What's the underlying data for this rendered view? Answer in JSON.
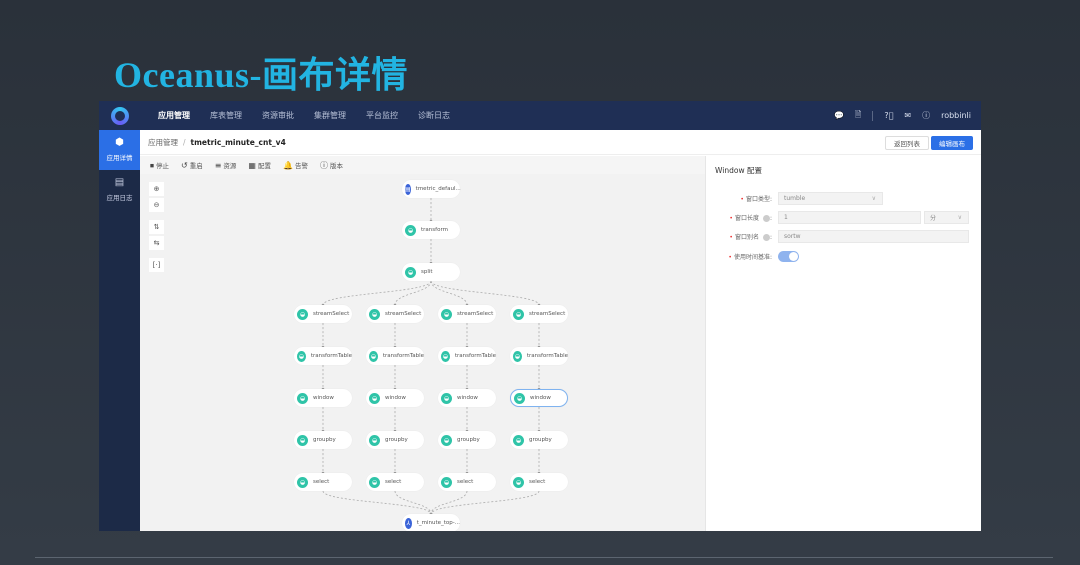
{
  "slide_title": "Oceanus-画布详情",
  "nav": {
    "items": [
      "应用管理",
      "库表管理",
      "资源审批",
      "集群管理",
      "平台监控",
      "诊断日志"
    ],
    "active": 0,
    "user": "robbinli"
  },
  "sidebar": [
    {
      "label": "应用详情",
      "icon": "cube-icon",
      "active": true
    },
    {
      "label": "应用日志",
      "icon": "log-icon",
      "active": false
    }
  ],
  "breadcrumb": {
    "parent": "应用管理",
    "separator": "/",
    "current": "tmetric_minute_cnt_v4"
  },
  "buttons": {
    "back": "返回列表",
    "edit": "编辑画布"
  },
  "toolbar": [
    {
      "icon": "⏹",
      "label": "停止"
    },
    {
      "icon": "↺",
      "label": "重启"
    },
    {
      "icon": "≡",
      "label": "资源"
    },
    {
      "icon": "▦",
      "label": "配置"
    },
    {
      "icon": "🔔",
      "label": "告警"
    },
    {
      "icon": "ⓘ",
      "label": "版本"
    }
  ],
  "canvas_tools": [
    "zoom-in",
    "zoom-out",
    "align-top",
    "align-left",
    "fit"
  ],
  "graph": {
    "source": "tmetric_defaul...",
    "chain": [
      "transform",
      "split"
    ],
    "columns": [
      [
        "streamSelect",
        "transformTable",
        "window",
        "groupby",
        "select"
      ],
      [
        "streamSelect",
        "transformTable",
        "window",
        "groupby",
        "select"
      ],
      [
        "streamSelect",
        "transformTable",
        "window",
        "groupby",
        "select"
      ],
      [
        "streamSelect",
        "transformTable",
        "window",
        "groupby",
        "select"
      ]
    ],
    "sink": "t_minute_top-...",
    "selected": {
      "column": 3,
      "row": 2
    }
  },
  "panel": {
    "title": "Window 配置",
    "fields": [
      {
        "label": "窗口类型",
        "value": "tumble"
      },
      {
        "label": "窗口长度",
        "value": "1",
        "unit": "分"
      },
      {
        "label": "窗口别名",
        "value": "sortw"
      },
      {
        "label": "使用时间基准",
        "toggle": true
      }
    ]
  }
}
